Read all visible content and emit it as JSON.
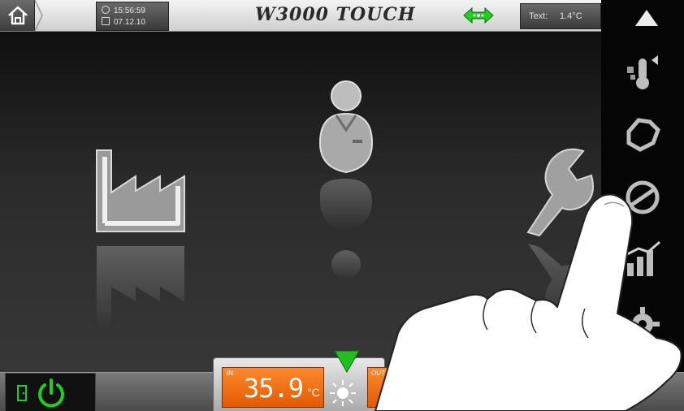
{
  "header": {
    "time": "15:56:59",
    "date": "07.12.10",
    "app_title": "W3000 TOUCH",
    "text_label": "Text:",
    "text_value": "1.4°C"
  },
  "icons": {
    "home": "home-icon",
    "clock": "clock-icon",
    "calendar": "calendar-icon",
    "link": "link-arrows-icon",
    "sidebar_up": "triangle-up-icon",
    "sidebar": [
      "thermometer-icon",
      "recycle-icon",
      "no-entry-icon",
      "trend-chart-icon",
      "gear-icon"
    ],
    "main": [
      "factory-icon",
      "user-icon",
      "wrench-icon"
    ],
    "power": "power-icon",
    "sun": "sun-icon"
  },
  "bottom": {
    "in_label": "IN",
    "in_value": "35.9",
    "in_unit": "°C",
    "out_label": "OUT"
  },
  "colors": {
    "accent_orange": "#f07a1c",
    "accent_green": "#1fd01f",
    "bar_light": "#e6e6e6"
  }
}
